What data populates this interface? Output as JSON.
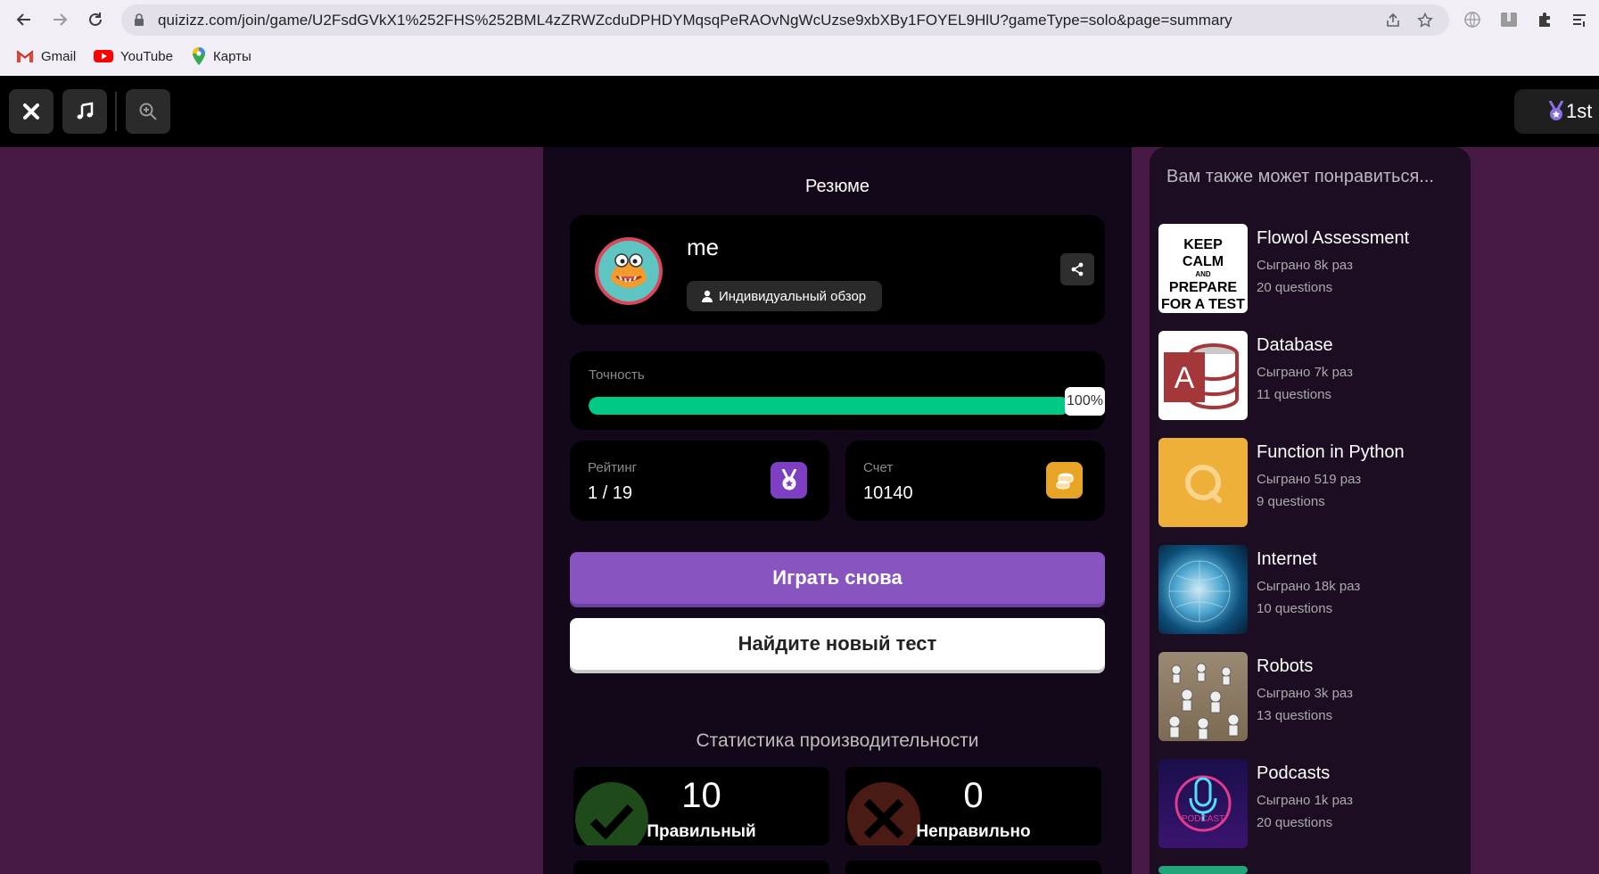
{
  "browser": {
    "url": "quizizz.com/join/game/U2FsdGVkX1%252FHS%252BML4zZRWZcduDPHDYMqsqPeRAOvNgWcUzse9xbXBy1FOYEL9HlU?gameType=solo&page=summary",
    "bookmarks": [
      {
        "label": "Gmail",
        "icon": "gmail-icon"
      },
      {
        "label": "YouTube",
        "icon": "youtube-icon"
      },
      {
        "label": "Карты",
        "icon": "maps-icon"
      }
    ]
  },
  "topbar": {
    "close_icon": "close-icon",
    "music_icon": "music-icon",
    "zoom_icon": "zoom-icon",
    "rank_label": "1st"
  },
  "summary": {
    "title": "Резюме",
    "player": {
      "name": "me",
      "review_button": "Индивидуальный обзор"
    },
    "accuracy": {
      "label": "Точность",
      "percent": 100,
      "percent_label": "100%"
    },
    "rating": {
      "label": "Рейтинг",
      "value": "1 / 19"
    },
    "score": {
      "label": "Счет",
      "value": "10140"
    },
    "play_again": "Играть снова",
    "find_new": "Найдите новый тест",
    "performance": {
      "title": "Статистика производительности",
      "correct": {
        "value": "10",
        "label": "Правильный"
      },
      "incorrect": {
        "value": "0",
        "label": "Неправильно"
      }
    }
  },
  "recommendations": {
    "title": "Вам также может понравиться...",
    "items": [
      {
        "name": "Flowol Assessment",
        "plays": "Сыграно 8k раз",
        "questions": "20 questions",
        "thumb_text": [
          "KEEP",
          "CALM",
          "AND",
          "PREPARE",
          "FOR A TEST"
        ]
      },
      {
        "name": "Database",
        "plays": "Сыграно 7k раз",
        "questions": "11 questions",
        "thumb_text": [
          "A"
        ]
      },
      {
        "name": "Function in Python",
        "plays": "Сыграно 519 раз",
        "questions": "9 questions"
      },
      {
        "name": "Internet",
        "plays": "Сыграно 18k раз",
        "questions": "10 questions"
      },
      {
        "name": "Robots",
        "plays": "Сыграно 3k раз",
        "questions": "13 questions"
      },
      {
        "name": "Podcasts",
        "plays": "Сыграно 1k раз",
        "questions": "20 questions",
        "thumb_text": [
          "PODCAST"
        ]
      }
    ]
  },
  "colors": {
    "page_bg": "#461a44",
    "accent_purple": "#8854c0",
    "accuracy_green": "#00c985",
    "coin_gold": "#e8a525"
  }
}
